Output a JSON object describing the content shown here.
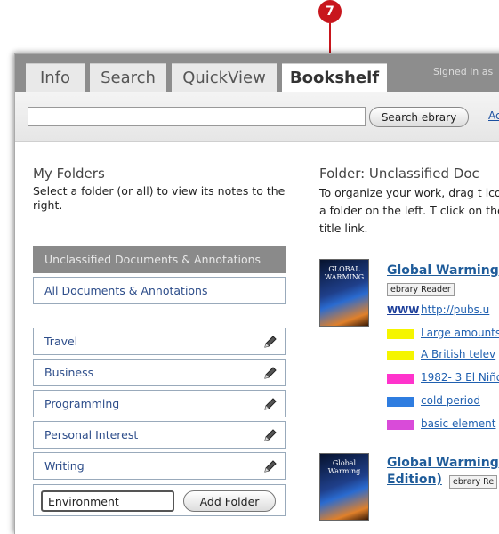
{
  "callout": {
    "number": "7"
  },
  "tabs": [
    {
      "label": "Info"
    },
    {
      "label": "Search"
    },
    {
      "label": "QuickView"
    },
    {
      "label": "Bookshelf",
      "active": true
    }
  ],
  "header": {
    "signed_in": "Signed in as"
  },
  "search": {
    "value": "",
    "placeholder": "",
    "button_label": "Search ebrary",
    "adv_link": "Ac"
  },
  "folders": {
    "title": "My Folders",
    "description": "Select a folder (or all) to view its notes to the right.",
    "items": [
      {
        "label": "Unclassified Documents & Annotations",
        "selected": true,
        "editable": false
      },
      {
        "label": "All Documents & Annotations",
        "selected": false,
        "editable": false
      },
      {
        "label": "Travel",
        "editable": true
      },
      {
        "label": "Business",
        "editable": true
      },
      {
        "label": "Programming",
        "editable": true
      },
      {
        "label": "Personal Interest",
        "editable": true
      },
      {
        "label": "Writing",
        "editable": true
      }
    ],
    "new_folder_value": "Environment",
    "add_button_label": "Add Folder"
  },
  "content": {
    "title": "Folder: Unclassified Doc",
    "description": "To organize your work, drag t icon to a folder on the left. T click on the title link.",
    "books": [
      {
        "title": "Global Warming :",
        "cover_text": "GLOBAL WARMING",
        "badge": "ebrary Reader",
        "annotations": [
          {
            "type": "www",
            "icon_text": "WWW",
            "text": "http://pubs.u"
          },
          {
            "type": "highlight",
            "color": "#f5f500",
            "text": "Large amounts"
          },
          {
            "type": "highlight",
            "color": "#f5f500",
            "text": "A British telev"
          },
          {
            "type": "highlight",
            "color": "#ff33cc",
            "text": "1982- 3 El Niño"
          },
          {
            "type": "highlight",
            "color": "#2f7de0",
            "text": "cold period"
          },
          {
            "type": "highlight",
            "color": "#d94bd9",
            "text": "basic element"
          }
        ]
      },
      {
        "title_line1": "Global Warming :",
        "title_line2": "Edition)",
        "cover_text": "Global Warming",
        "badge": "ebrary Re"
      }
    ]
  }
}
